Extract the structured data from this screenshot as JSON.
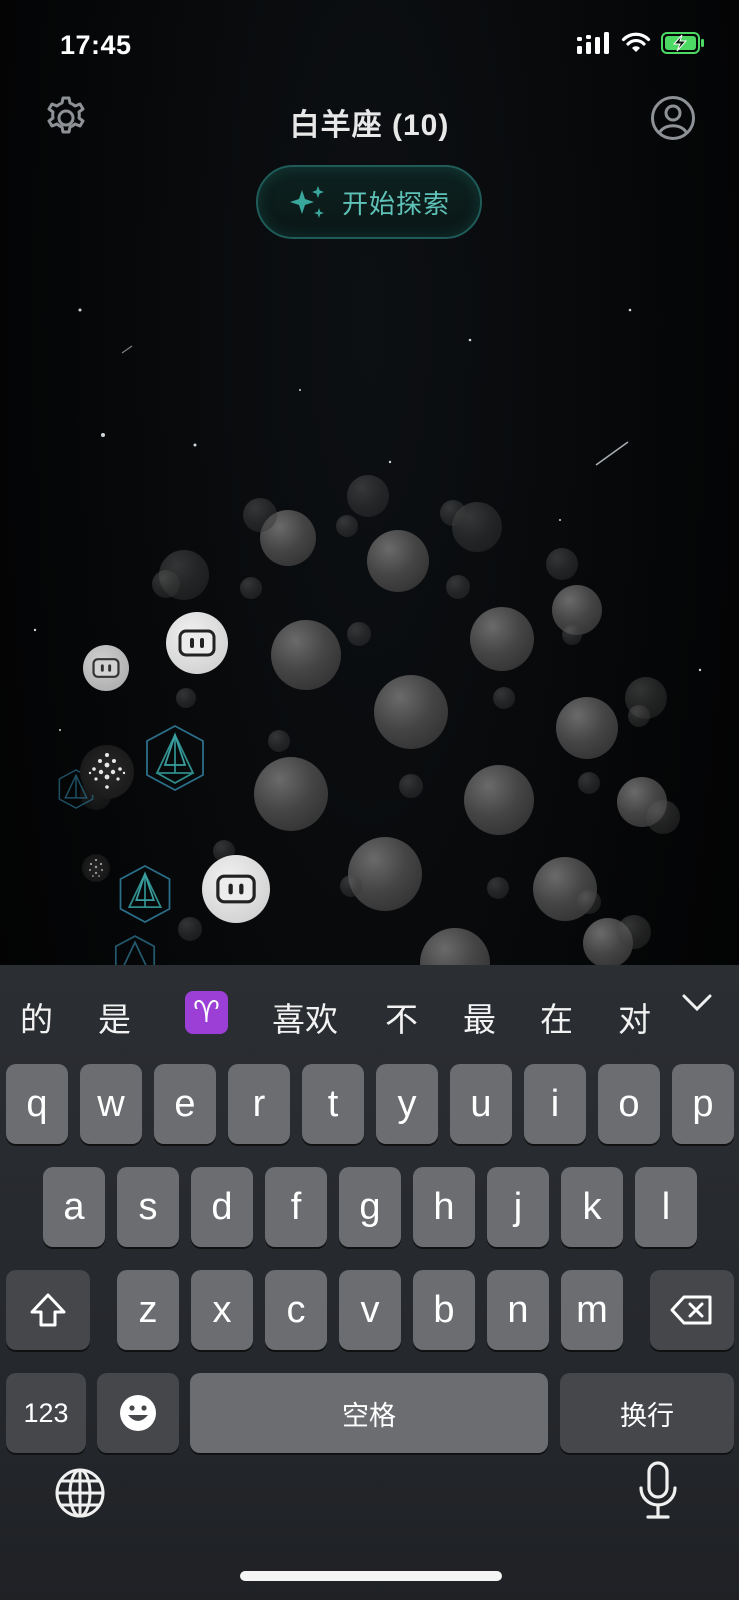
{
  "status_bar": {
    "time": "17:45",
    "battery_color": "#4cd964"
  },
  "header": {
    "title": "白羊座 (10)",
    "explore_label": "开始探索",
    "accent_color": "#5fc2b8"
  },
  "icons": {
    "settings": "gear-icon",
    "profile": "user-circle-icon",
    "explore": "sparkle-icon"
  },
  "candidates": [
    "的",
    "是",
    "♈",
    "喜欢",
    "不",
    "最",
    "在",
    "对"
  ],
  "keyboard": {
    "row1": [
      "q",
      "w",
      "e",
      "r",
      "t",
      "y",
      "u",
      "i",
      "o",
      "p"
    ],
    "row2": [
      "a",
      "s",
      "d",
      "f",
      "g",
      "h",
      "j",
      "k",
      "l"
    ],
    "row3": [
      "z",
      "x",
      "c",
      "v",
      "b",
      "n",
      "m"
    ],
    "numbers_label": "123",
    "space_label": "空格",
    "return_label": "换行"
  }
}
